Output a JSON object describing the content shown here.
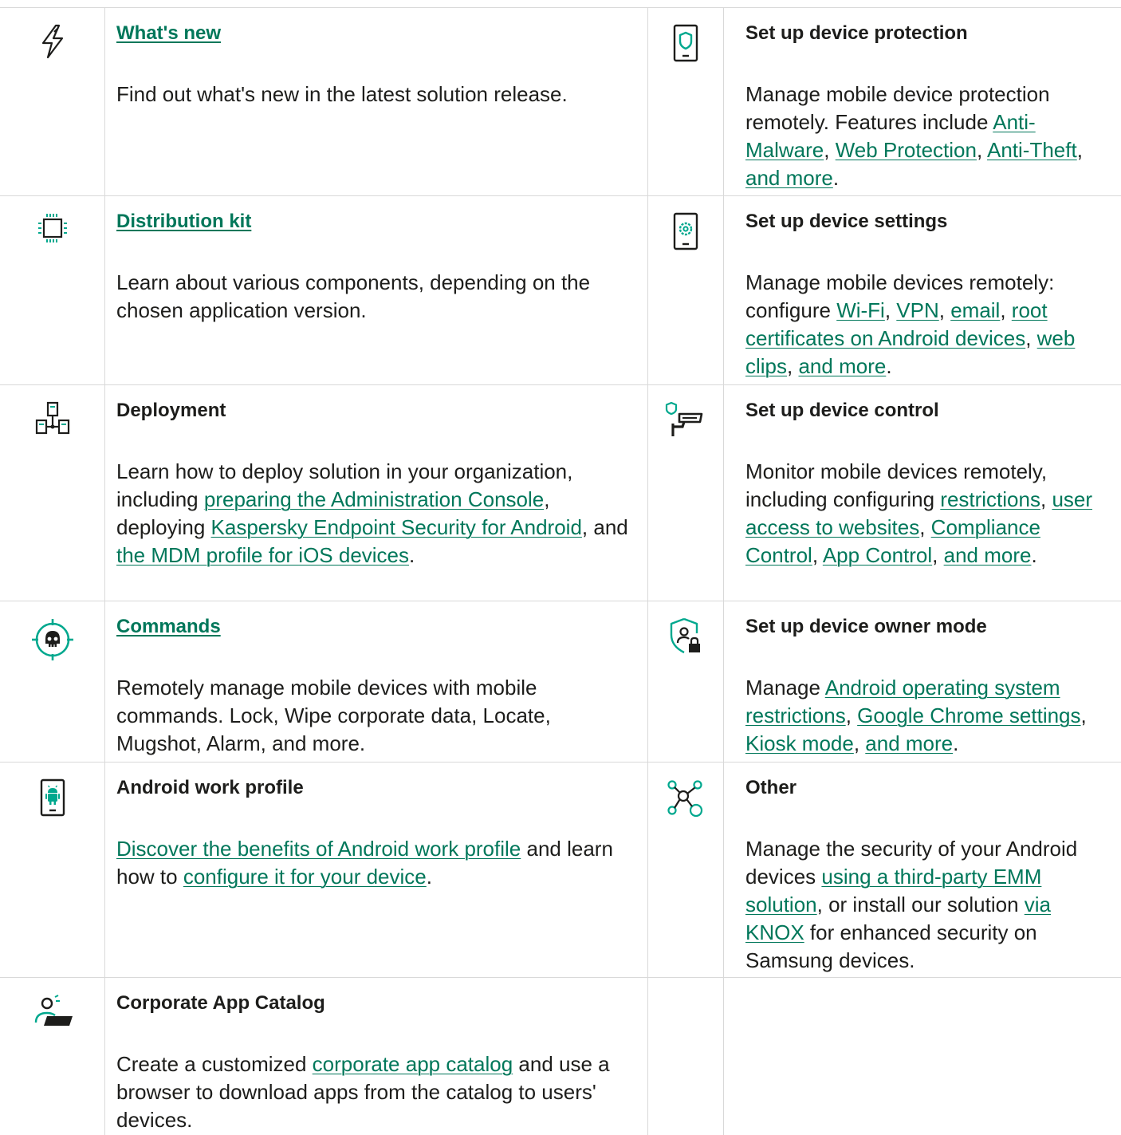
{
  "colors": {
    "accent": "#00775a",
    "icon_teal": "#00a88e",
    "text": "#1d1d1b",
    "border": "#d9d9d9"
  },
  "cards": {
    "whats_new": {
      "icon": "lightning-icon",
      "title": "What's new",
      "desc": "Find out what's new in the latest solution release."
    },
    "device_protection": {
      "icon": "shield-phone-icon",
      "title": "Set up device protection",
      "desc_pre": "Manage mobile device protection remotely. Features include ",
      "link_antimalware": "Anti-Malware",
      "sep1": ", ",
      "link_web_protection": "Web Protection",
      "sep2": ", ",
      "link_antitheft": "Anti-Theft",
      "sep3": ", ",
      "link_more": "and more",
      "end": "."
    },
    "distribution_kit": {
      "icon": "chip-icon",
      "title": "Distribution kit",
      "desc": "Learn about various components, depending on the chosen application version."
    },
    "device_settings": {
      "icon": "phone-gear-icon",
      "title": "Set up device settings",
      "desc_pre": "Manage mobile devices remotely: configure ",
      "link_wifi": "Wi-Fi",
      "sep1": ", ",
      "link_vpn": "VPN",
      "sep2": ", ",
      "link_email": "email",
      "sep3": ", ",
      "link_root_certs": "root certificates on Android devices",
      "sep4": ", ",
      "link_web_clips": "web clips",
      "sep5": ", ",
      "link_more": "and more",
      "end": "."
    },
    "deployment": {
      "icon": "network-icon",
      "title": "Deployment",
      "desc_pre": "Learn how to deploy solution in your organization, including ",
      "link_console": "preparing the Administration Console",
      "mid1": ", deploying ",
      "link_kes": "Kaspersky Endpoint Security for Android",
      "mid2": ", and ",
      "link_mdm": "the MDM profile for iOS devices",
      "end": "."
    },
    "device_control": {
      "icon": "shield-camera-icon",
      "title": "Set up device control",
      "desc_pre": "Monitor mobile devices remotely, including configuring ",
      "link_restrictions": "restrictions",
      "sep1": ", ",
      "link_websites": "user access to websites",
      "sep2": ", ",
      "link_compliance": "Compliance Control",
      "sep3": ", ",
      "link_app_control": "App Control",
      "sep4": ", ",
      "link_more": "and more",
      "end": "."
    },
    "commands": {
      "icon": "skull-target-icon",
      "title": "Commands",
      "desc": "Remotely manage mobile devices with mobile commands. Lock, Wipe corporate data, Locate, Mugshot, Alarm, and more."
    },
    "device_owner": {
      "icon": "shield-user-lock-icon",
      "title": "Set up device owner mode",
      "desc_pre": "Manage ",
      "link_android_restrictions": "Android operating system restrictions",
      "sep1": ", ",
      "link_chrome": "Google Chrome settings",
      "sep2": ", ",
      "link_kiosk": "Kiosk mode",
      "sep3": ", ",
      "link_more": "and more",
      "end": "."
    },
    "work_profile": {
      "icon": "android-phone-icon",
      "title": "Android work profile",
      "link_benefits": "Discover the benefits of Android work profile",
      "mid1": " and learn how to ",
      "link_configure": "configure it for your device",
      "end": "."
    },
    "other": {
      "icon": "nodes-icon",
      "title": "Other",
      "desc_pre": "Manage the security of your Android devices ",
      "link_emm": "using a third-party EMM solution",
      "mid1": ", or install our solution ",
      "link_knox": "via KNOX",
      "end": " for enhanced security on Samsung devices."
    },
    "app_catalog": {
      "icon": "user-laptop-icon",
      "title": "Corporate App Catalog",
      "desc_pre": "Create a customized ",
      "link_catalog": "corporate app catalog",
      "end": " and use a browser to download apps from the catalog to users' devices."
    }
  }
}
